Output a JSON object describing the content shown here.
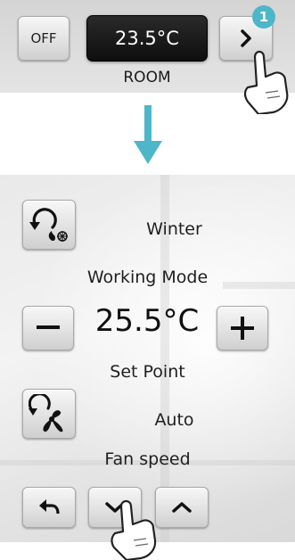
{
  "room_panel": {
    "off_label": "OFF",
    "temperature": "23.5°C",
    "room_label": "ROOM",
    "step_badge": "1"
  },
  "settings_panel": {
    "working_mode_value": "Winter",
    "working_mode_label": "Working Mode",
    "set_point_value": "25.5°C",
    "set_point_label": "Set Point",
    "fan_speed_value": "Auto",
    "fan_speed_label": "Fan speed"
  },
  "icons": {
    "next": "chevron-right-icon",
    "transition": "arrow-down-icon",
    "working_mode": "cycle-heat-cool-icon",
    "fan": "fan-icon",
    "back": "return-arrow-icon",
    "down": "chevron-down-icon",
    "up": "chevron-up-icon",
    "pointer": "hand-pointer-icon"
  },
  "colors": {
    "accent": "#4db6c9",
    "display_bg": "#111111",
    "panel_bg": "#d9d9d9"
  }
}
